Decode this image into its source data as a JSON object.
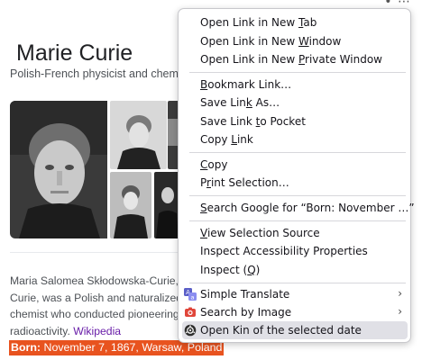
{
  "toolbar": {
    "glyphs": "• ⋯"
  },
  "knowledge_panel": {
    "title": "Marie Curie",
    "subtitle": "Polish-French physicist and chemist",
    "description_lines": [
      "Maria Salomea Skłodowska-Curie, kn",
      "Curie, was a Polish and naturalized-F",
      "chemist who conducted pioneering re",
      "radioactivity."
    ],
    "source_link": "Wikipedia",
    "born_label": "Born:",
    "born_value": " November 7, 1867, Warsaw, Poland"
  },
  "context_menu": {
    "items": [
      {
        "pre": "Open Link in New ",
        "key": "T",
        "post": "ab"
      },
      {
        "pre": "Open Link in New ",
        "key": "W",
        "post": "indow"
      },
      {
        "pre": "Open Link in New ",
        "key": "P",
        "post": "rivate Window"
      },
      {
        "pre": "",
        "key": "B",
        "post": "ookmark Link…"
      },
      {
        "pre": "Save Lin",
        "key": "k",
        "post": " As…"
      },
      {
        "pre": "Save Link ",
        "key": "t",
        "post": "o Pocket"
      },
      {
        "pre": "Copy ",
        "key": "L",
        "post": "ink"
      },
      {
        "pre": "",
        "key": "C",
        "post": "opy"
      },
      {
        "pre": "P",
        "key": "r",
        "post": "int Selection…"
      },
      {
        "pre": "",
        "key": "S",
        "post": "earch Google for “Born: November …”"
      },
      {
        "pre": "",
        "key": "V",
        "post": "iew Selection Source"
      },
      {
        "pre": "Inspect Accessibility Properties",
        "key": "",
        "post": ""
      },
      {
        "pre": "Inspect (",
        "key": "Q",
        "post": ")"
      },
      {
        "pre": "Simple Translate",
        "key": "",
        "post": ""
      },
      {
        "pre": "Search by Image",
        "key": "",
        "post": ""
      },
      {
        "pre": "Open Kin of the selected date",
        "key": "",
        "post": ""
      }
    ],
    "icons": {
      "translate": "simple-translate-icon",
      "image_search": "search-by-image-icon",
      "kin": "kin-extension-icon"
    },
    "submenu_arrow": "›"
  },
  "colors": {
    "selection": "#e8531f",
    "link_visited": "#681da8",
    "menu_hover": "#e0e0e6",
    "translate_icon": "#5b5fc7",
    "image_search_icon": "#e0463a"
  }
}
